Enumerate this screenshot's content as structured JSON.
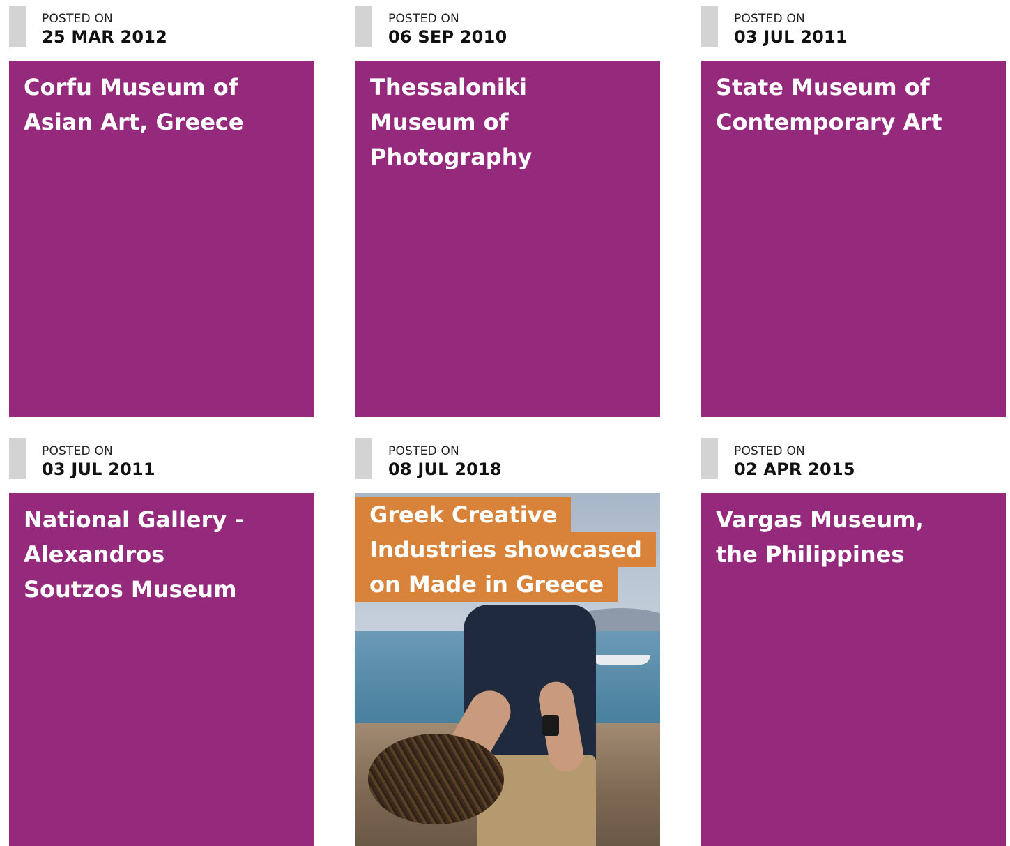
{
  "posts": [
    {
      "posted_label": "POSTED ON",
      "date": "25 MAR 2012",
      "title": "Corfu Museum of Asian Art, Greece"
    },
    {
      "posted_label": "POSTED ON",
      "date": "06 SEP 2010",
      "title": "Thessaloniki Museum of Photography"
    },
    {
      "posted_label": "POSTED ON",
      "date": "03 JUL 2011",
      "title": "State Museum of Contemporary Art"
    },
    {
      "posted_label": "POSTED ON",
      "date": "03 JUL 2011",
      "title": "National Gallery - Alexandros Soutzos Museum"
    },
    {
      "posted_label": "POSTED ON",
      "date": "08 JUL 2018",
      "title_lines": [
        "Greek Creative",
        "Industries showcased",
        "on Made in Greece"
      ]
    },
    {
      "posted_label": "POSTED ON",
      "date": "02 APR 2015",
      "title": "Vargas Museum, the Philippines"
    }
  ],
  "colors": {
    "card_background": "#952a7d",
    "title_highlight": "#d9833a",
    "date_bar": "#d3d3d3"
  }
}
